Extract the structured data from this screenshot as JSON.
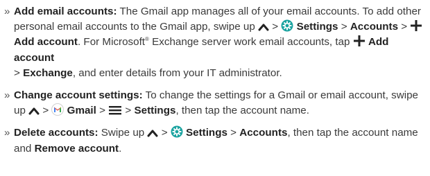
{
  "items": [
    {
      "bullet": "»",
      "title": "Add email accounts:",
      "p1": " The Gmail app manages all of your email accounts. To add other personal email accounts to the Gmail app, swipe up ",
      "sep1": " > ",
      "settings": "Settings",
      "sep2": " > ",
      "accounts": "Accounts",
      "sep3": " > ",
      "add_account": "Add account",
      "p2": ". For Microsoft",
      "reg": "®",
      "p3": " Exchange server work email accounts, tap ",
      "add_account2": "Add account",
      "sep4": " > ",
      "exchange": "Exchange",
      "p4": ", and enter details from your IT administrator."
    },
    {
      "bullet": "»",
      "title": "Change account settings:",
      "p1": " To change the settings for a Gmail or email account, swipe up ",
      "sep1": " > ",
      "gmail": "Gmail",
      "sep2": " > ",
      "sep3": " > ",
      "settings": "Settings",
      "p2": ", then tap the account name."
    },
    {
      "bullet": "»",
      "title": "Delete accounts:",
      "p1": " Swipe up ",
      "sep1": " > ",
      "settings": "Settings",
      "sep2": " > ",
      "accounts": "Accounts",
      "p2": ", then tap the account name and ",
      "remove": "Remove account",
      "p3": "."
    }
  ],
  "icons": {
    "caret": "chevron-up-icon",
    "settings": "settings-gear-icon",
    "plus": "plus-icon",
    "gmail": "gmail-icon",
    "menu": "hamburger-menu-icon"
  },
  "colors": {
    "text": "#3a3a3a",
    "settings_teal": "#1aa3a0",
    "gmail_red": "#e0463b"
  }
}
